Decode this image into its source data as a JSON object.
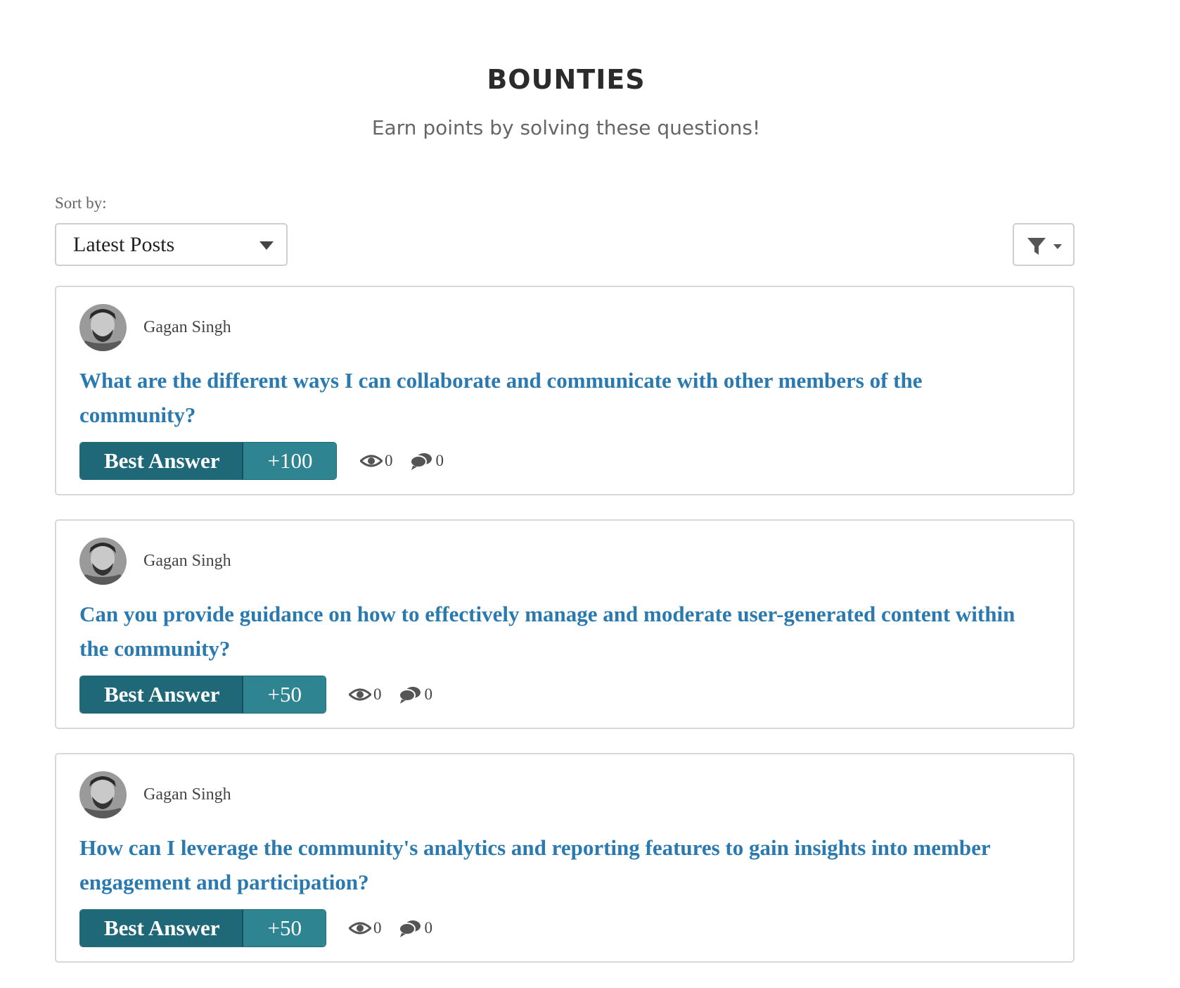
{
  "header": {
    "title": "BOUNTIES",
    "subtitle": "Earn points by solving these questions!"
  },
  "sort": {
    "label": "Sort by:",
    "selected": "Latest Posts"
  },
  "icons": {
    "filter": "filter-icon",
    "views": "eye-icon",
    "replies": "comments-icon"
  },
  "colors": {
    "link": "#2a7ab0",
    "bounty_label_bg": "#1f6877",
    "bounty_points_bg": "#2f8491"
  },
  "posts": [
    {
      "author": "Gagan Singh",
      "question": "What are the different ways I can collaborate and communicate with other members of the community?",
      "bounty_label": "Best Answer",
      "bounty_points": "+100",
      "views": "0",
      "replies": "0"
    },
    {
      "author": "Gagan Singh",
      "question": "Can you provide guidance on how to effectively manage and moderate user-generated content within the community?",
      "bounty_label": "Best Answer",
      "bounty_points": "+50",
      "views": "0",
      "replies": "0"
    },
    {
      "author": "Gagan Singh",
      "question": "How can I leverage the community's analytics and reporting features to gain insights into member engagement and participation?",
      "bounty_label": "Best Answer",
      "bounty_points": "+50",
      "views": "0",
      "replies": "0"
    }
  ]
}
